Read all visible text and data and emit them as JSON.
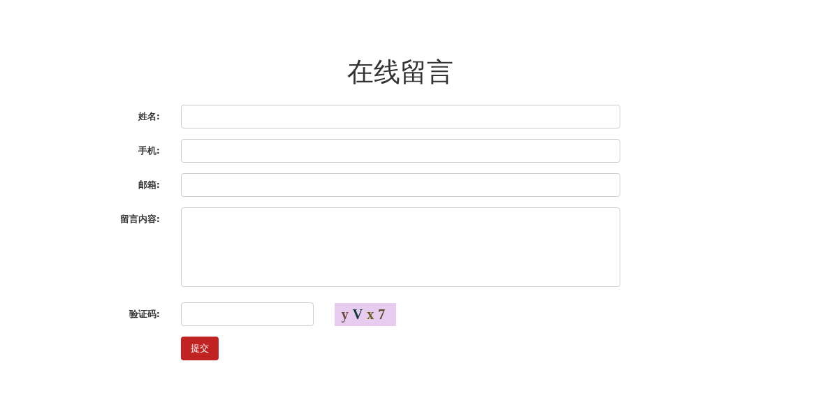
{
  "title": "在线留言",
  "fields": [
    {
      "label": "姓名:",
      "kind": "text"
    },
    {
      "label": "手机:",
      "kind": "text"
    },
    {
      "label": "邮箱:",
      "kind": "text"
    },
    {
      "label": "留言内容:",
      "kind": "textarea"
    },
    {
      "label": "验证码:",
      "kind": "captcha"
    }
  ],
  "captcha": {
    "text": "yVx7"
  },
  "submit": "提交"
}
